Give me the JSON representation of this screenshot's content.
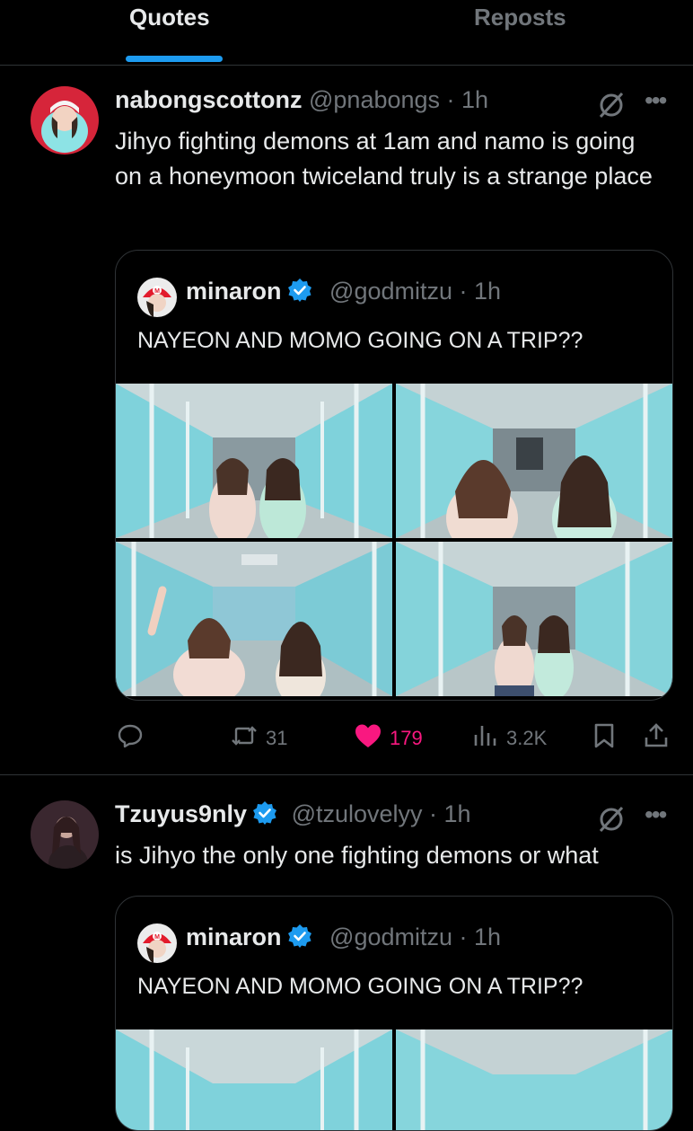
{
  "tabs": {
    "quotes": "Quotes",
    "reposts": "Reposts"
  },
  "posts": [
    {
      "name": "nabongscottonz",
      "handle": "@pnabongs",
      "time": "· 1h",
      "text": "Jihyo fighting demons at 1am and namo is going on a honeymoon twiceland truly is a strange place",
      "verified": false,
      "quote": {
        "name": "minaron",
        "handle": "@godmitzu",
        "time": "· 1h",
        "text": "NAYEON AND MOMO GOING ON A TRIP??"
      },
      "actions": {
        "reposts": "31",
        "likes": "179",
        "views": "3.2K"
      }
    },
    {
      "name": "Tzuyus9nly",
      "handle": "@tzulovelyy",
      "time": "· 1h",
      "text": "is Jihyo the only one fighting demons or what",
      "verified": true,
      "quote": {
        "name": "minaron",
        "handle": "@godmitzu",
        "time": "· 1h",
        "text": "NAYEON AND MOMO GOING ON A TRIP??"
      }
    }
  ],
  "icons": {
    "reply": "speech-bubble-icon",
    "repost": "repost-arrows-icon",
    "like": "heart-icon",
    "views": "bar-chart-icon",
    "bookmark": "bookmark-icon",
    "share": "share-upload-icon",
    "grok": "slashed-circle-icon",
    "more": "ellipsis-icon"
  },
  "colors": {
    "accent": "#1d9bf0",
    "like": "#f91880",
    "muted": "#71767b",
    "text": "#e7e9ea"
  }
}
